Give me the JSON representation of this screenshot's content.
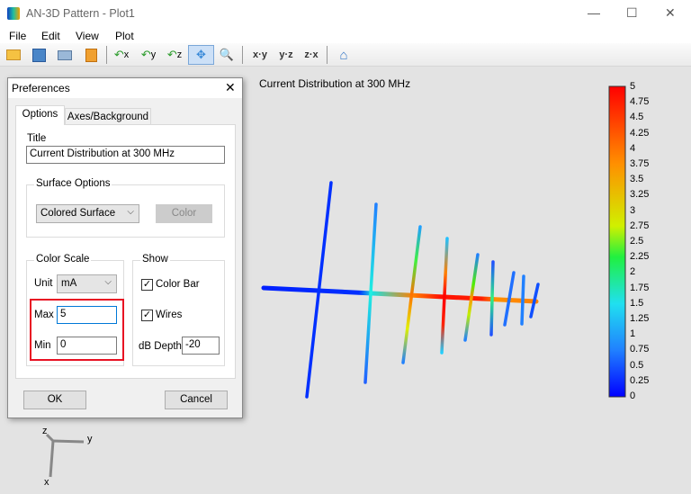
{
  "window": {
    "title": "AN-3D Pattern - Plot1",
    "controls": {
      "minimize": "—",
      "maximize": "☐",
      "close": "✕"
    }
  },
  "menu": [
    "File",
    "Edit",
    "View",
    "Plot"
  ],
  "toolbar": {
    "icons": [
      "open-folder-icon",
      "save-icon",
      "print-icon",
      "clipboard-icon",
      "rotate-x-icon",
      "rotate-y-icon",
      "rotate-z-icon",
      "pan-icon",
      "zoom-icon",
      "home-icon"
    ],
    "rotate_x": "x",
    "rotate_y": "y",
    "rotate_z": "z",
    "view_xy": "x·y",
    "view_yz": "y·z",
    "view_zx": "z·x"
  },
  "plot": {
    "title": "Current Distribution at 300 MHz",
    "colorbar": {
      "labels": [
        "5",
        "4.75",
        "4.5",
        "4.25",
        "4",
        "3.75",
        "3.5",
        "3.25",
        "3",
        "2.75",
        "2.5",
        "2.25",
        "2",
        "1.75",
        "1.5",
        "1.25",
        "1",
        "0.75",
        "0.5",
        "0.25",
        "0"
      ],
      "min": 0,
      "max": 5
    },
    "axes": {
      "x": "x",
      "y": "y",
      "z": "z"
    }
  },
  "dialog": {
    "title": "Preferences",
    "close": "✕",
    "tabs": [
      "Options",
      "Axes/Background"
    ],
    "title_label": "Title",
    "title_value": "Current Distribution at 300 MHz",
    "surface": {
      "legend": "Surface Options",
      "select": "Colored Surface",
      "color_button": "Color"
    },
    "color_scale": {
      "legend": "Color Scale",
      "unit_label": "Unit",
      "unit": "mA",
      "max_label": "Max",
      "max": "5",
      "min_label": "Min",
      "min": "0"
    },
    "show": {
      "legend": "Show",
      "color_bar": "Color Bar",
      "color_bar_checked": true,
      "wires": "Wires",
      "wires_checked": true,
      "db_label": "dB Depth",
      "db": "-20"
    },
    "ok": "OK",
    "cancel": "Cancel"
  },
  "colors": {
    "highlight": "#e81123",
    "accent": "#0078d7"
  }
}
